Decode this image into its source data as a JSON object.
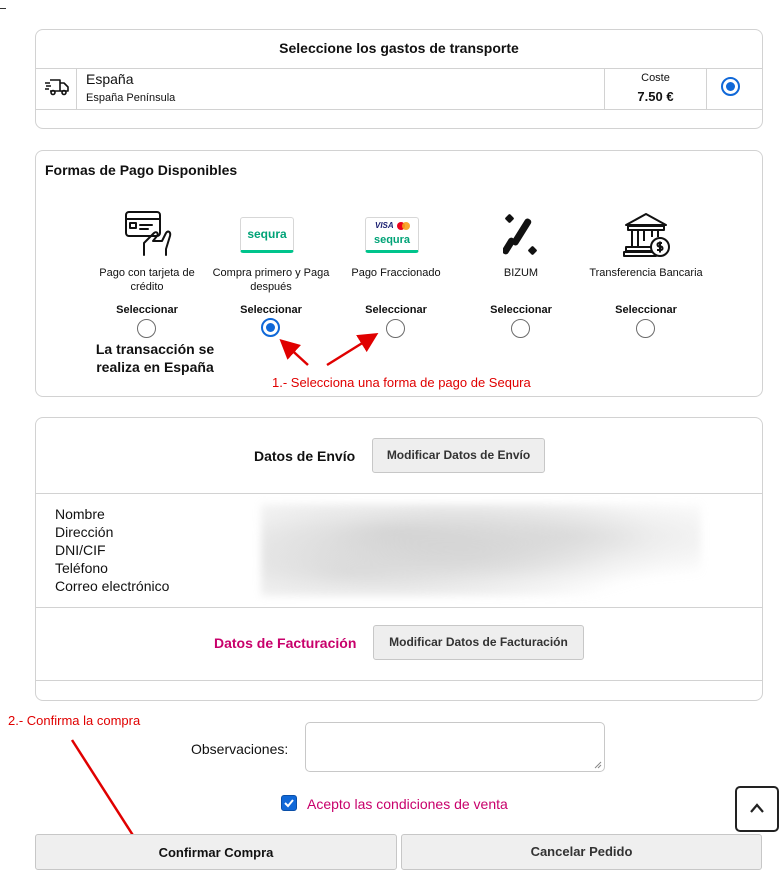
{
  "shipping": {
    "title": "Seleccione los gastos de transporte",
    "country": "España",
    "region": "España Península",
    "cost_label": "Coste",
    "cost_value": "7.50 €",
    "selected": true
  },
  "payment": {
    "title": "Formas de Pago Disponibles",
    "select_label": "Seleccionar",
    "methods": [
      {
        "label": "Pago con tarjeta de crédito",
        "icon": "card-hand-icon",
        "selected": false
      },
      {
        "label": "Compra primero y Paga después",
        "icon": "sequra-logo",
        "logo_text": "sequra",
        "selected": true
      },
      {
        "label": "Pago Fraccionado",
        "icon": "sequra-visa-logo",
        "logo_text": "sequra",
        "visa_text": "VISA",
        "selected": false
      },
      {
        "label": "BIZUM",
        "icon": "bizum-icon",
        "selected": false
      },
      {
        "label": "Transferencia Bancaria",
        "icon": "bank-icon",
        "selected": false
      }
    ],
    "note": "La transacción se realiza en España",
    "annotation": "1.- Selecciona una forma de pago de Sequra"
  },
  "shipping_data": {
    "label": "Datos de Envío",
    "modify_button": "Modificar Datos de Envío",
    "fields": [
      "Nombre",
      "Dirección",
      "DNI/CIF",
      "Teléfono",
      "Correo electrónico"
    ]
  },
  "billing_data": {
    "label": "Datos de Facturación",
    "modify_button": "Modificar Datos de Facturación"
  },
  "observations": {
    "label": "Observaciones:",
    "value": ""
  },
  "terms": {
    "label": "Acepto las condiciones de venta",
    "checked": true
  },
  "confirm_annotation": "2.- Confirma la compra",
  "buttons": {
    "confirm": "Confirmar Compra",
    "cancel": "Cancelar Pedido"
  },
  "colors": {
    "accent_blue": "#1068d8",
    "billing_magenta": "#c8006b",
    "annotation_red": "#e00000",
    "sequra_green": "#00a377"
  }
}
